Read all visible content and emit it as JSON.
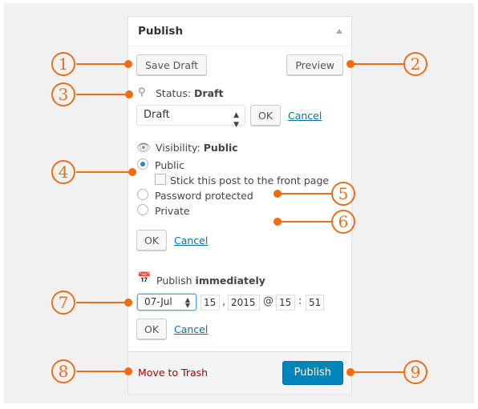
{
  "panel": {
    "title": "Publish",
    "save_draft": "Save Draft",
    "preview": "Preview",
    "status_label": "Status:",
    "status_value": "Draft",
    "status_select": "Draft",
    "ok": "OK",
    "cancel": "Cancel",
    "visibility_label": "Visibility:",
    "visibility_value": "Public",
    "options": [
      "Public",
      "Password protected",
      "Private"
    ],
    "sticky": "Stick this post to the front page",
    "publish_label": "Publish",
    "publish_value": "immediately",
    "date": {
      "month": "07-Jul",
      "day": "15",
      "sep1": ",",
      "year": "2015",
      "at": "@",
      "hour": "15",
      "colon": ":",
      "minute": "51"
    },
    "trash": "Move to Trash",
    "publish_button": "Publish"
  },
  "callouts": [
    "1",
    "2",
    "3",
    "4",
    "5",
    "6",
    "7",
    "8",
    "9"
  ],
  "colors": {
    "accent": "#e8701a",
    "primary": "#0085ba",
    "link": "#0073aa",
    "trash": "#a00"
  }
}
